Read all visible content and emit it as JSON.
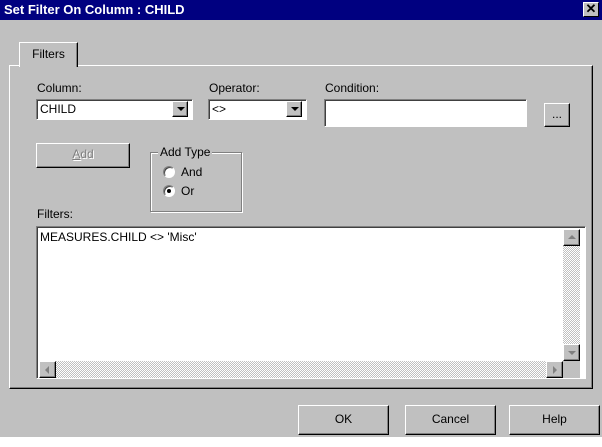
{
  "window": {
    "title": "Set Filter On Column : CHILD",
    "close_glyph": "✕"
  },
  "tabs": [
    {
      "label": "Filters"
    }
  ],
  "column": {
    "label": "Column:",
    "value": "CHILD"
  },
  "operator": {
    "label": "Operator:",
    "value": "<>"
  },
  "condition": {
    "label": "Condition:",
    "value": "",
    "browse_label": "..."
  },
  "add_button": {
    "label_mnemonic": "A",
    "label_rest": "dd",
    "enabled": false
  },
  "add_type": {
    "label": "Add Type",
    "options": [
      {
        "label": "And",
        "selected": false
      },
      {
        "label": "Or",
        "selected": true
      }
    ]
  },
  "filters": {
    "label": "Filters:",
    "text": "MEASURES.CHILD <> 'Misc'"
  },
  "buttons": {
    "ok": "OK",
    "cancel": "Cancel",
    "help": "Help"
  },
  "icons": {
    "dropdown": "chevron-down-icon",
    "close": "close-icon",
    "scroll_up": "arrow-up-icon",
    "scroll_down": "arrow-down-icon",
    "scroll_left": "arrow-left-icon",
    "scroll_right": "arrow-right-icon"
  },
  "colors": {
    "titlebar": "#000080",
    "face": "#c0c0c0",
    "disabled_text": "#808080"
  }
}
